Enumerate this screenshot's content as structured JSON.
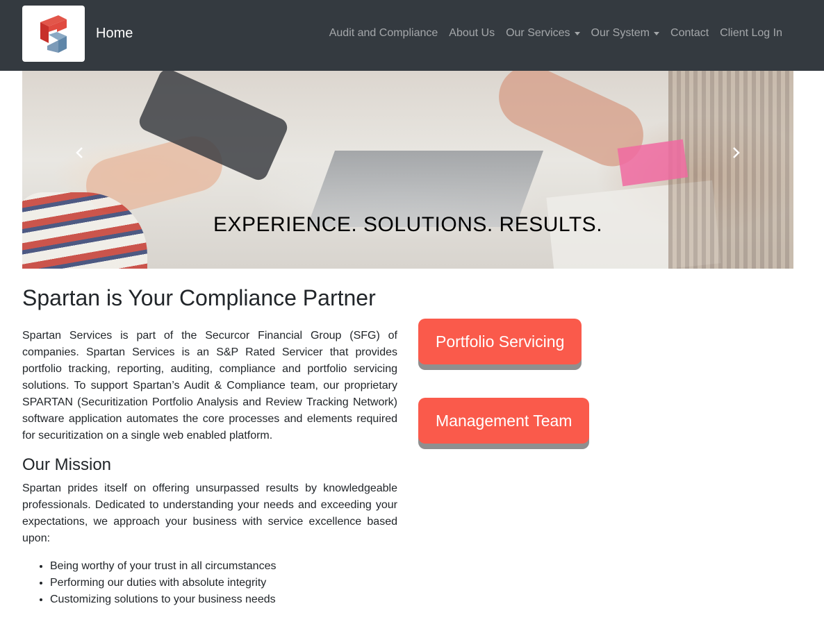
{
  "navbar": {
    "brand_label": "Home",
    "logo_icon": "spartan-cube-logo-icon",
    "items": [
      {
        "label": "Audit and Compliance",
        "dropdown": false
      },
      {
        "label": "About Us",
        "dropdown": false
      },
      {
        "label": "Our Services",
        "dropdown": true
      },
      {
        "label": "Our System",
        "dropdown": true
      },
      {
        "label": "Contact",
        "dropdown": false
      },
      {
        "label": "Client Log In",
        "dropdown": false
      }
    ]
  },
  "carousel": {
    "caption": "EXPERIENCE. SOLUTIONS. RESULTS.",
    "prev_icon": "chevron-left-icon",
    "next_icon": "chevron-right-icon"
  },
  "main": {
    "title": "Spartan is Your Compliance Partner",
    "intro": "Spartan Services is part of the Securcor Financial Group (SFG) of companies. Spartan Services is an S&P Rated Servicer that provides portfolio tracking, reporting, auditing, compliance and portfolio servicing solutions. To support Spartan’s Audit & Compliance team, our proprietary SPARTAN (Securitization Portfolio Analysis and Review Tracking Network) software application automates the core processes and elements required for securitization on a single web enabled platform.",
    "mission_heading": "Our Mission",
    "mission_text": "Spartan prides itself on offering unsurpassed results by knowledgeable professionals. Dedicated to understanding your needs and exceeding your expectations, we approach your business with service excellence based upon:",
    "values": [
      "Being worthy of your trust in all circumstances",
      "Performing our duties with absolute integrity",
      "Customizing solutions to your business needs"
    ]
  },
  "buttons": {
    "portfolio": "Portfolio Servicing",
    "management": "Management Team"
  },
  "colors": {
    "navbar_bg": "#343a40",
    "accent_button": "#fa5a4b",
    "button_shadow": "#8f8f8f"
  }
}
